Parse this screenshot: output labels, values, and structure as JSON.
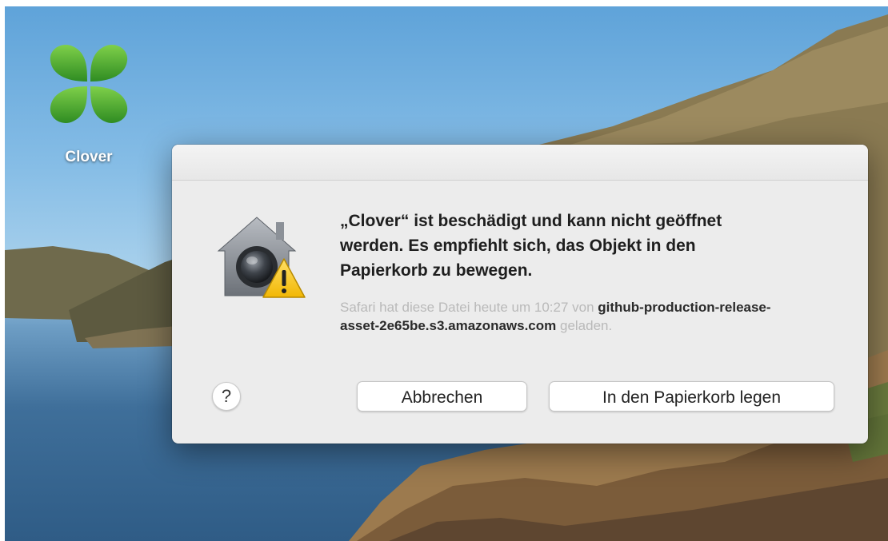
{
  "desktop": {
    "icon_label": "Clover",
    "icon_name": "clover-app-icon"
  },
  "dialog": {
    "headline": "„Clover“ ist beschädigt und kann nicht geöffnet werden. Es empfiehlt sich, das Objekt in den Papierkorb zu bewegen.",
    "info_prefix": "Safari hat diese Datei heute um 10:27 von ",
    "info_source": "github-production-release-asset-2e65be.s3.amazonaws.com",
    "info_suffix": " geladen.",
    "help_label": "?",
    "cancel_label": "Abbrechen",
    "trash_label": "In den Papierkorb legen",
    "icon_name": "gatekeeper-warning-icon"
  },
  "colors": {
    "dialog_bg": "#ececec",
    "warning_yellow": "#f6c51b",
    "clover_green": "#4fae34"
  }
}
